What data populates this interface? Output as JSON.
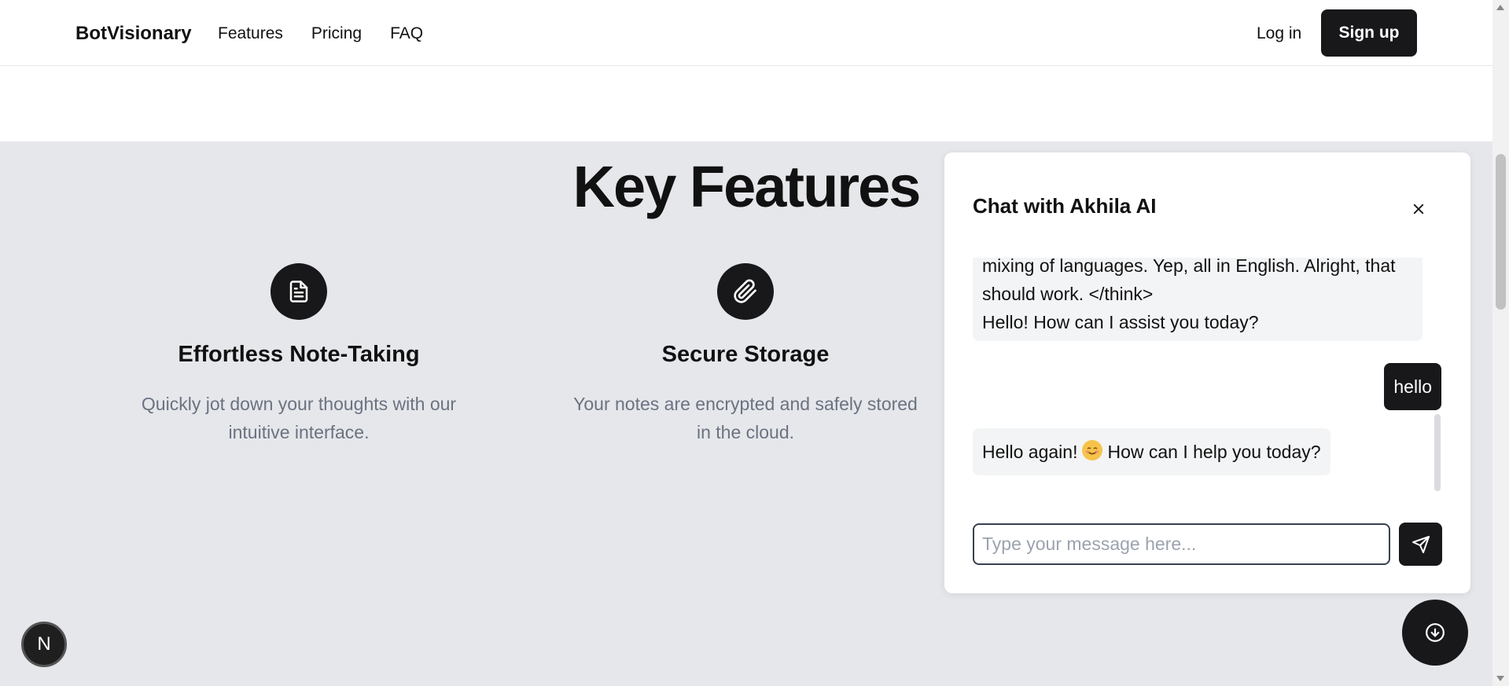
{
  "header": {
    "brand": "BotVisionary",
    "nav": [
      "Features",
      "Pricing",
      "FAQ"
    ],
    "login_label": "Log in",
    "signup_label": "Sign up"
  },
  "features_section": {
    "title": "Key Features",
    "items": [
      {
        "icon": "document-icon",
        "title": "Effortless Note-Taking",
        "description": "Quickly jot down your thoughts with our intuitive interface."
      },
      {
        "icon": "paperclip-icon",
        "title": "Secure Storage",
        "description": "Your notes are encrypted and safely stored in the cloud."
      }
    ]
  },
  "chat": {
    "title": "Chat with Akhila AI",
    "messages": [
      {
        "role": "bot",
        "lines": [
          "mixing of languages. Yep, all in English. Alright, that",
          "should work. </think>",
          "Hello! How can I assist you today?"
        ]
      },
      {
        "role": "user",
        "text": "hello"
      },
      {
        "role": "bot",
        "text_before": "Hello again!",
        "emoji": "smiling-face",
        "text_after": "How can I help you today?"
      }
    ],
    "input_placeholder": "Type your message here...",
    "input_value": ""
  },
  "badge": {
    "letter": "N"
  },
  "colors": {
    "dark": "#18181b",
    "section_bg": "#e5e7eb",
    "muted_text": "#6b7280"
  }
}
